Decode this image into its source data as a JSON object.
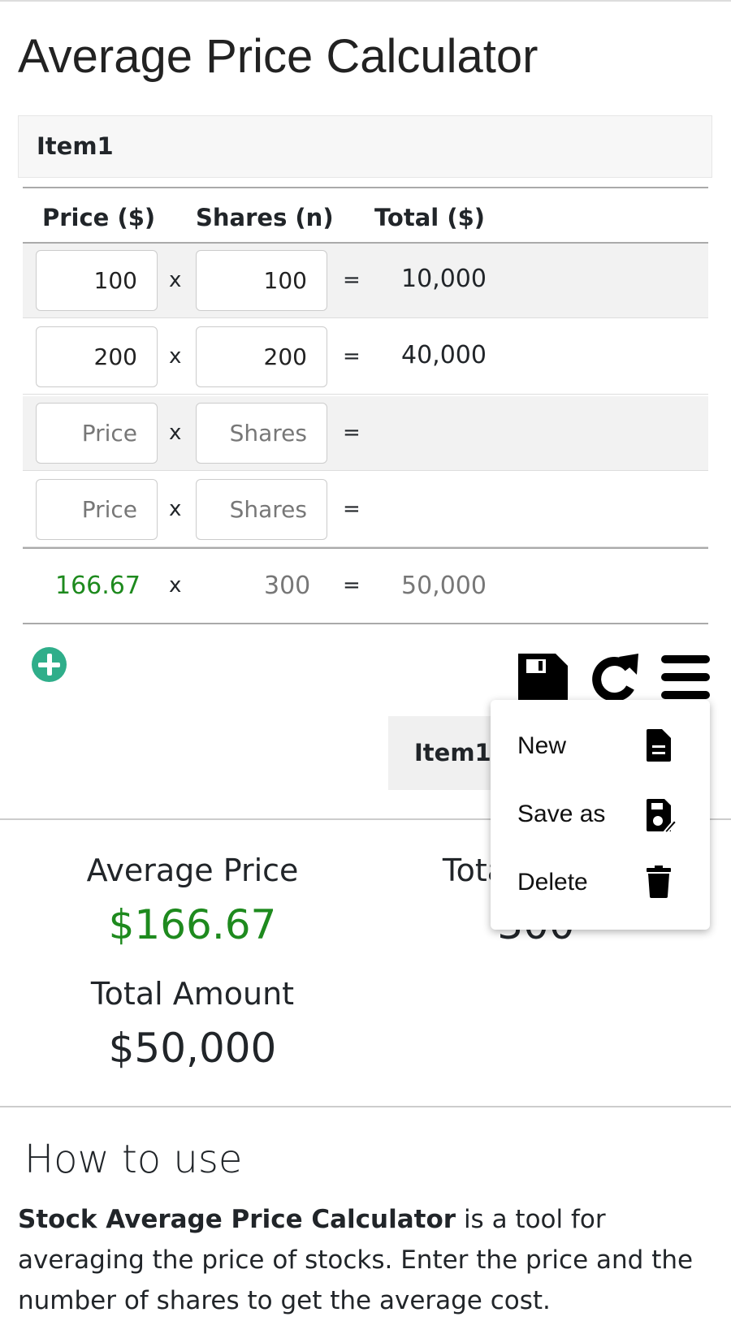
{
  "title": "Average Price Calculator",
  "card_title": "Item1",
  "table": {
    "headers": [
      "Price ($)",
      "Shares (n)",
      "Total ($)"
    ],
    "rows": [
      {
        "price": "100",
        "shares": "100",
        "total": "10,000"
      },
      {
        "price": "200",
        "shares": "200",
        "total": "40,000"
      },
      {
        "price": "",
        "shares": "",
        "total": ""
      },
      {
        "price": "",
        "shares": "",
        "total": ""
      }
    ],
    "placeholders": {
      "price": "Price",
      "shares": "Shares"
    },
    "op_times": "x",
    "op_equals": "=",
    "summary": {
      "price": "166.67",
      "shares": "300",
      "total": "50,000"
    }
  },
  "tab_label": "Item1",
  "menu": {
    "items": [
      {
        "label": "New",
        "icon": "file-icon"
      },
      {
        "label": "Save as",
        "icon": "save-edit-icon"
      },
      {
        "label": "Delete",
        "icon": "trash-icon"
      }
    ]
  },
  "results": {
    "avg_label": "Average Price",
    "avg_value": "$166.67",
    "total_shares_label": "Total Shares",
    "total_shares_value": "300",
    "amount_label": "Total Amount",
    "amount_value": "$50,000"
  },
  "howto": {
    "title": "How to use",
    "bold": "Stock Average Price Calculator",
    "text": " is a tool for averaging the price of stocks. Enter the price and the number of shares to get the average cost."
  },
  "colors": {
    "accent_green": "#1e8a1e",
    "add_button": "#2fae8a"
  }
}
